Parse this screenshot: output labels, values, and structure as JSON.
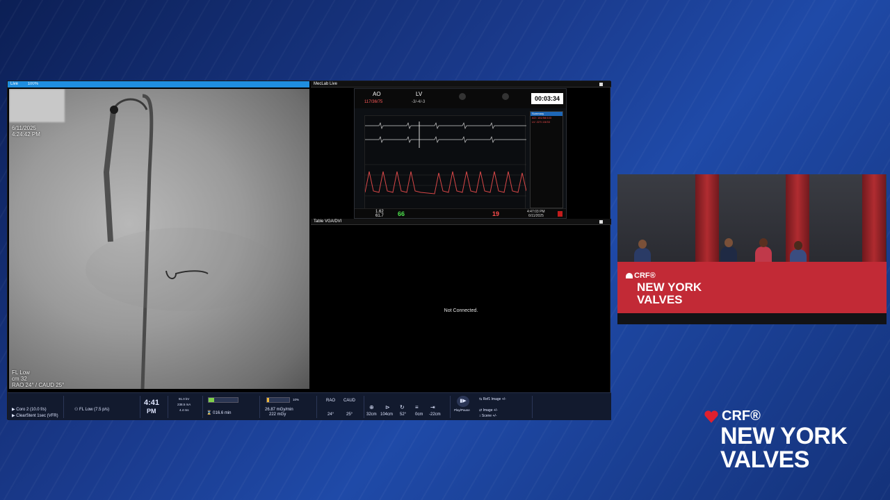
{
  "monitor": {
    "live": {
      "title": "Live",
      "zoom": "100%"
    },
    "meclab": {
      "title": "MecLab Live"
    },
    "table": {
      "title": "Table VGA/DVI",
      "status": "Not Connected."
    },
    "fluoro_overlay": {
      "top_left": [
        "6/11/2025",
        "4:24:42 PM"
      ],
      "bottom_left": [
        "FL Low",
        "cm 32",
        "RAO 24° / CAUD 25°"
      ]
    },
    "hemo": {
      "ao_label": "AO",
      "ao_value": "117/36/75",
      "lv_label": "LV",
      "lv_value": "-3/-4/-3",
      "timer": "00:03:34",
      "side_title": "Summary",
      "side_lines": [
        "AO: 181/58/103",
        "LV: 227/-15/33"
      ],
      "bottom": {
        "v1": "1.62",
        "v2": "61.7",
        "hr": "66",
        "v3": "19",
        "time": "4:47:03 PM",
        "date": "6/11/2025"
      }
    },
    "controls": {
      "protocol": "Coro 2 (10.0 f/s)",
      "stent": "ClearStent 1sec (VFR)",
      "fl": "FL Low (7.5 p/s)",
      "clock_time": "4:41",
      "clock_ampm": "PM",
      "kv": "91.0 kV",
      "ma": "238.5 mA",
      "ms": "4.4 ms",
      "fluoro_time": "016.6 min",
      "dose_rate": "26.87 mGy/min",
      "dose": "222 mGy",
      "dose_pct": "10%",
      "rao_label": "RAO",
      "rao_val": "24°",
      "caud_label": "CAUD",
      "caud_val": "25°",
      "pos1": "32cm",
      "pos2": "104cm",
      "pos3": "52°",
      "pos4": "0cm",
      "pos5": "-22cm",
      "play": "Play/Pause",
      "ref": "Ref1 Image +/-",
      "image": "Image +/-",
      "scene": "Scene +/-"
    }
  },
  "video": {
    "table_brand": "CRF®",
    "table_title_1": "NEW YORK",
    "table_title_2": "VALVES"
  },
  "brand": {
    "crf": "CRF®",
    "line1": "NEW YORK",
    "line2": "VALVES",
    "heart_color": "#e0202e"
  }
}
